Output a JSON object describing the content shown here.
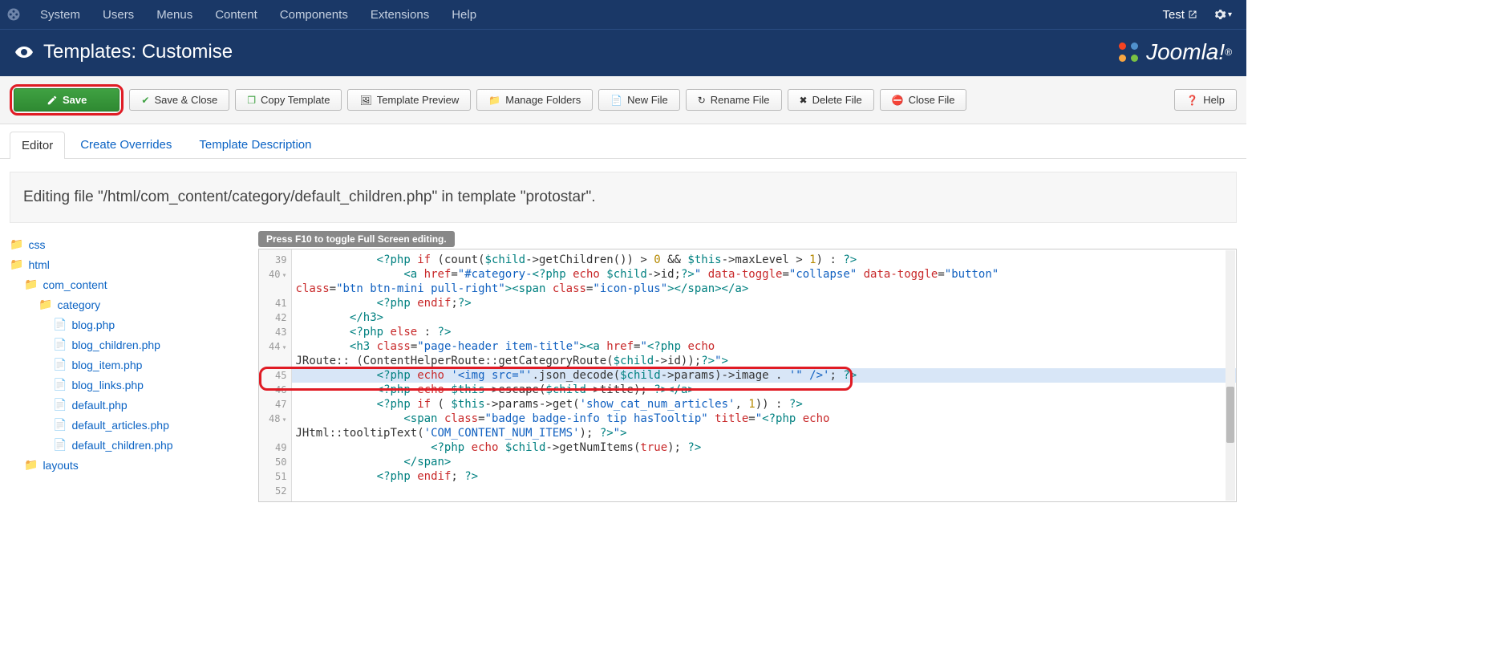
{
  "topnav": {
    "items": [
      "System",
      "Users",
      "Menus",
      "Content",
      "Components",
      "Extensions",
      "Help"
    ],
    "test": "Test"
  },
  "header": {
    "title": "Templates: Customise",
    "brand": "Joomla!"
  },
  "toolbar": {
    "save": "Save",
    "save_close": "Save & Close",
    "copy_template": "Copy Template",
    "template_preview": "Template Preview",
    "manage_folders": "Manage Folders",
    "new_file": "New File",
    "rename_file": "Rename File",
    "delete_file": "Delete File",
    "close_file": "Close File",
    "help": "Help"
  },
  "tabs": {
    "editor": "Editor",
    "overrides": "Create Overrides",
    "description": "Template Description"
  },
  "banner": "Editing file \"/html/com_content/category/default_children.php\" in template \"protostar\".",
  "tree": {
    "css": "css",
    "html": "html",
    "com_content": "com_content",
    "category": "category",
    "files": [
      "blog.php",
      "blog_children.php",
      "blog_item.php",
      "blog_links.php",
      "default.php",
      "default_articles.php",
      "default_children.php"
    ],
    "layouts": "layouts"
  },
  "editor": {
    "hint": "Press F10 to toggle Full Screen editing.",
    "line_numbers": [
      "39",
      "40",
      "41",
      "42",
      "43",
      "44",
      "45",
      "46",
      "47",
      "48",
      "49",
      "50",
      "51",
      "52"
    ],
    "folds": [
      1,
      5,
      9
    ],
    "lines_html": [
      "            <span class='t-tag'>&lt;?php</span> <span class='t-kw'>if</span> (count(<span class='t-var'>$child</span>-&gt;getChildren()) &gt; <span class='t-num'>0</span> &amp;&amp; <span class='t-var'>$this</span>-&gt;maxLevel &gt; <span class='t-num'>1</span>) : <span class='t-tag'>?&gt;</span>",
      "                <span class='t-tag'>&lt;a</span> <span class='t-kw'>href</span>=<span class='t-str'>\"#category-</span><span class='t-tag'>&lt;?php</span> <span class='t-kw'>echo</span> <span class='t-var'>$child</span>-&gt;id;<span class='t-tag'>?&gt;</span><span class='t-str'>\"</span> <span class='t-kw'>data-toggle</span>=<span class='t-str'>\"collapse\"</span> <span class='t-kw'>data-toggle</span>=<span class='t-str'>\"button\"</span>\n<span class='t-kw'>class</span>=<span class='t-str'>\"btn btn-mini pull-right\"</span><span class='t-tag'>&gt;&lt;span</span> <span class='t-kw'>class</span>=<span class='t-str'>\"icon-plus\"</span><span class='t-tag'>&gt;&lt;/span&gt;&lt;/a&gt;</span>",
      "            <span class='t-tag'>&lt;?php</span> <span class='t-kw'>endif</span>;<span class='t-tag'>?&gt;</span>",
      "        <span class='t-tag'>&lt;/h3&gt;</span>",
      "        <span class='t-tag'>&lt;?php</span> <span class='t-kw'>else</span> : <span class='t-tag'>?&gt;</span>",
      "        <span class='t-tag'>&lt;h3</span> <span class='t-kw'>class</span>=<span class='t-str'>\"page-header item-title\"</span><span class='t-tag'>&gt;&lt;a</span> <span class='t-kw'>href</span>=<span class='t-str'>\"</span><span class='t-tag'>&lt;?php</span> <span class='t-kw'>echo</span>\nJRoute::_(ContentHelperRoute::getCategoryRoute(<span class='t-var'>$child</span>-&gt;id));<span class='t-tag'>?&gt;</span><span class='t-str'>\"</span><span class='t-tag'>&gt;</span>",
      "            <span class='t-tag'>&lt;?php</span> <span class='t-kw'>echo</span> <span class='t-str'>'&lt;img src=\"'</span>.json_decode(<span class='t-var'>$child</span>-&gt;params)-&gt;image . <span class='t-str'>'\" /&gt;'</span>; <span class='t-tag'>?&gt;</span>",
      "            <span class='t-tag'>&lt;?php</span> <span class='t-kw'>echo</span> <span class='t-var'>$this</span>-&gt;escape(<span class='t-var'>$child</span>-&gt;title); <span class='t-tag'>?&gt;&lt;/a&gt;</span>",
      "            <span class='t-tag'>&lt;?php</span> <span class='t-kw'>if</span> ( <span class='t-var'>$this</span>-&gt;params-&gt;get(<span class='t-str'>'show_cat_num_articles'</span>, <span class='t-num'>1</span>)) : <span class='t-tag'>?&gt;</span>",
      "                <span class='t-tag'>&lt;span</span> <span class='t-kw'>class</span>=<span class='t-str'>\"badge badge-info tip hasTooltip\"</span> <span class='t-kw'>title</span>=<span class='t-str'>\"</span><span class='t-tag'>&lt;?php</span> <span class='t-kw'>echo</span>\nJHtml::tooltipText(<span class='t-str'>'COM_CONTENT_NUM_ITEMS'</span>); <span class='t-tag'>?&gt;</span><span class='t-str'>\"</span><span class='t-tag'>&gt;</span>",
      "                    <span class='t-tag'>&lt;?php</span> <span class='t-kw'>echo</span> <span class='t-var'>$child</span>-&gt;getNumItems(<span class='t-kw'>true</span>); <span class='t-tag'>?&gt;</span>",
      "                <span class='t-tag'>&lt;/span&gt;</span>",
      "            <span class='t-tag'>&lt;?php</span> <span class='t-kw'>endif</span>; <span class='t-tag'>?&gt;</span>",
      ""
    ]
  }
}
